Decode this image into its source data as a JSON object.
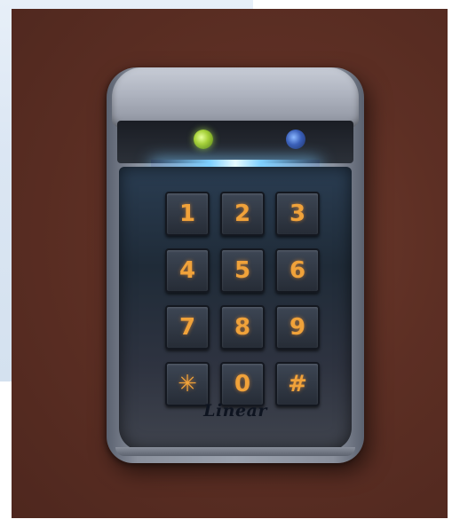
{
  "keypad": {
    "keys": [
      {
        "label": "1"
      },
      {
        "label": "2"
      },
      {
        "label": "3"
      },
      {
        "label": "4"
      },
      {
        "label": "5"
      },
      {
        "label": "6"
      },
      {
        "label": "7"
      },
      {
        "label": "8"
      },
      {
        "label": "9"
      },
      {
        "label": "✳"
      },
      {
        "label": "0"
      },
      {
        "label": "#"
      }
    ],
    "brand": "Linear",
    "indicator_colors": {
      "left_led": "#a7d23a",
      "right_led": "#3a5fb8",
      "key_glow": "#f0a23a",
      "backlight": "#7fd0ff"
    }
  }
}
